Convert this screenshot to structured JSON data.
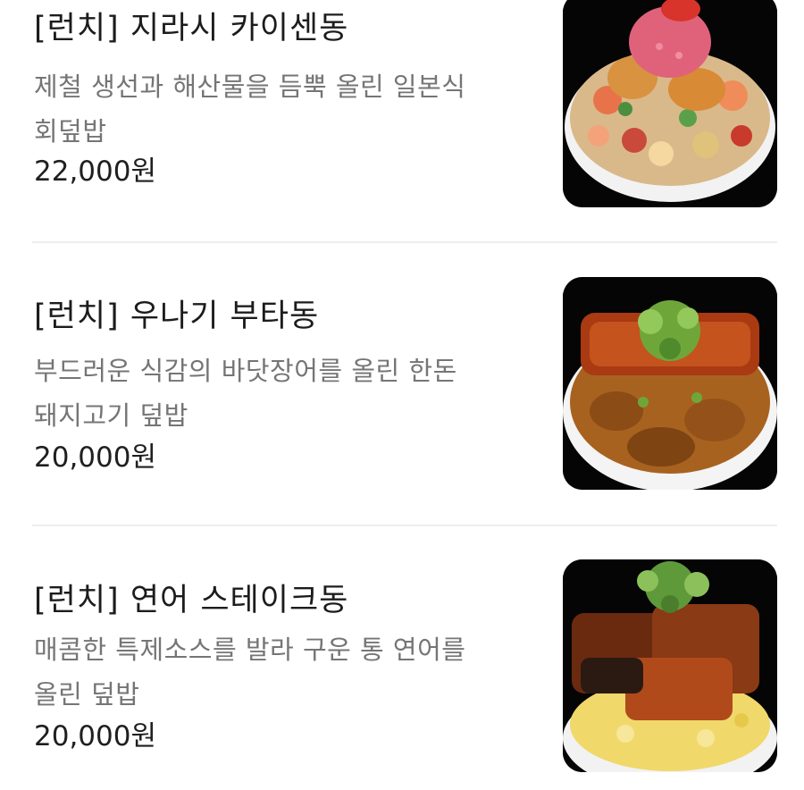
{
  "menu": {
    "items": [
      {
        "name": "[런치] 지라시 카이센동",
        "description_lines": [
          "제철 생선과 해산물을 듬뿍 올린 일본식",
          "회덮밥"
        ],
        "price": "22,000원"
      },
      {
        "name": "[런치] 우나기 부타동",
        "description_lines": [
          "부드러운 식감의 바닷장어를 올린 한돈",
          "돼지고기 덮밥"
        ],
        "price": "20,000원"
      },
      {
        "name": "[런치] 연어 스테이크동",
        "description_lines": [
          "매콤한 특제소스를 발라 구운 통 연어를",
          "올린 덮밥"
        ],
        "price": "20,000원"
      }
    ]
  }
}
